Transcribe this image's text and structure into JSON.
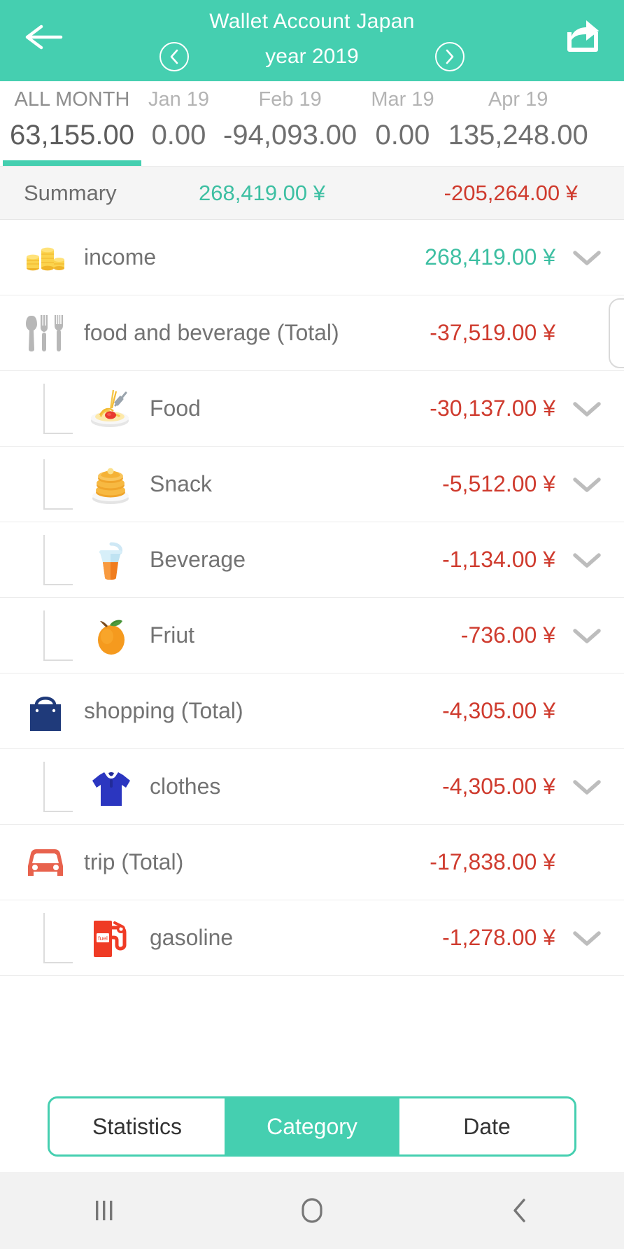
{
  "header": {
    "title": "Wallet Account Japan",
    "year_label": "year 2019",
    "back_icon": "arrow-left-icon",
    "share_icon": "share-icon",
    "prev_icon": "chevron-left-circle-icon",
    "next_icon": "chevron-right-circle-icon"
  },
  "month_tabs": [
    {
      "label": "ALL MONTH",
      "value": "63,155.00",
      "active": true
    },
    {
      "label": "Jan 19",
      "value": "0.00",
      "active": false
    },
    {
      "label": "Feb 19",
      "value": "-94,093.00",
      "active": false
    },
    {
      "label": "Mar 19",
      "value": "0.00",
      "active": false
    },
    {
      "label": "Apr 19",
      "value": "135,248.00",
      "active": false
    }
  ],
  "summary": {
    "label": "Summary",
    "income": "268,419.00 ¥",
    "expense": "-205,264.00 ¥"
  },
  "rows": [
    {
      "label": "income",
      "amount": "268,419.00 ¥",
      "sign": "pos",
      "icon": "coins-icon",
      "sub": false,
      "chevron": true
    },
    {
      "label": "food and beverage (Total)",
      "amount": "-37,519.00 ¥",
      "sign": "neg",
      "icon": "cutlery-icon",
      "sub": false,
      "chevron": false
    },
    {
      "label": "Food",
      "amount": "-30,137.00 ¥",
      "sign": "neg",
      "icon": "spaghetti-icon",
      "sub": true,
      "chevron": true
    },
    {
      "label": "Snack",
      "amount": "-5,512.00 ¥",
      "sign": "neg",
      "icon": "pancakes-icon",
      "sub": true,
      "chevron": true
    },
    {
      "label": "Beverage",
      "amount": "-1,134.00 ¥",
      "sign": "neg",
      "icon": "drink-cup-icon",
      "sub": true,
      "chevron": true
    },
    {
      "label": "Friut",
      "amount": "-736.00 ¥",
      "sign": "neg",
      "icon": "orange-fruit-icon",
      "sub": true,
      "chevron": true
    },
    {
      "label": "shopping (Total)",
      "amount": "-4,305.00 ¥",
      "sign": "neg",
      "icon": "shopping-bag-icon",
      "sub": false,
      "chevron": false
    },
    {
      "label": "clothes",
      "amount": "-4,305.00 ¥",
      "sign": "neg",
      "icon": "tshirt-icon",
      "sub": true,
      "chevron": true
    },
    {
      "label": "trip (Total)",
      "amount": "-17,838.00 ¥",
      "sign": "neg",
      "icon": "car-icon",
      "sub": false,
      "chevron": false
    },
    {
      "label": "gasoline",
      "amount": "-1,278.00 ¥",
      "sign": "neg",
      "icon": "fuel-pump-icon",
      "sub": true,
      "chevron": true
    }
  ],
  "segmented": {
    "options": [
      {
        "label": "Statistics",
        "active": false
      },
      {
        "label": "Category",
        "active": true
      },
      {
        "label": "Date",
        "active": false
      }
    ]
  },
  "navbar": {
    "recents_icon": "recents-icon",
    "home_icon": "home-icon",
    "back_icon": "back-icon"
  },
  "colors": {
    "accent": "#45cfb0",
    "income": "#3dbfa2",
    "expense": "#cf3b2e",
    "fuel_label": "fuel"
  }
}
